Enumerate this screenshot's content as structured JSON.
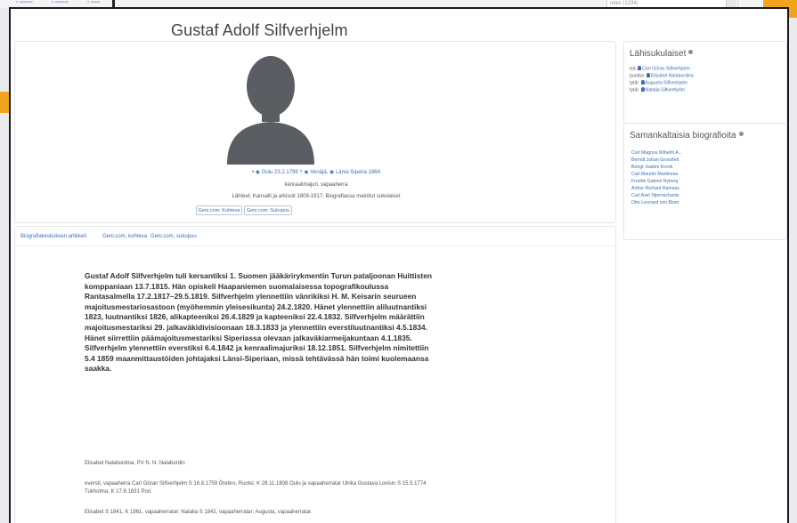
{
  "search": {
    "value": "mies (1234)"
  },
  "page": {
    "title": "Gustaf Adolf Silfverhjelm"
  },
  "profile": {
    "life_prefix": "•",
    "birth": "Oulu 23.2.1799 †",
    "death_place": "Venäjä",
    "region": "Länsi-Siperia 1864",
    "roles": "kenraalimajuri, vapaaherra",
    "sources": "Lähteet: Kansalli ja arkisoit 1809-1917. Biografiassa mainitut sukulaiset",
    "geni_buttons": [
      "Geni.com: Kohteva",
      "Geni.com: Sukupuu"
    ]
  },
  "tabs": [
    "Biografiakeskuksen artikkeli",
    "Geni.com, kohteva",
    "Geni.com, sukupuu"
  ],
  "bio": {
    "text": "Gustaf Adolf Silfverhjelm tuli kersantiksi 1. Suomen jääkärirykmentin Turun pataljoonan Huittisten komppaniaan 13.7.1815. Hän opiskeli Haapaniemen suomalaisessa topografikoulussa Rantasalmella 17.2.1817–29.5.1819. Silfverhjelm ylennettiin vänrikiksi H. M. Keisarin seurueen majoitusmestariosastoon (myöhemmin yleisesikunta) 24.2.1820. Hänet ylennettiin aliluutnantiksi 1823, luutnantiksi 1826, alikapteeniksi 26.4.1829 ja kapteeniksi 22.4.1832. Silfverhjelm määrättiin majoitusmestariksi 29. jalkaväkidivisioonaan 18.3.1833 ja ylennettiin everstiluutnantiksi 4.5.1834. Hänet siirrettiin päämajoitusmestariksi Siperiassa olevaan jalkaväkiarmeijakuntaan 4.1.1835. Silfverhjelm ylennettiin everstiksi 6.4.1842 ja kenraalimajuriksi 18.12.1851. Silfverhjelm nimitettiin 5.4 1859 maanmittaustöiden johtajaksi Länsi-Siperiaan, missä tehtävässä hän toimi kuolemaansa saakka.",
    "spouse": "Elisabet Nalabordina, PV N. N. Nalabordin",
    "parents": "eversti, vapaaherra Carl Göran Silfverhjelm S 16.8.1759 Örebro, Ruotsi, K 28.11.1808 Oulu ja vapaaherratar Ulrika Gustava Lovisin S 15.5.1774 Tukholma, K 17.8.1831 Pori.",
    "children": "Elisabet S 1841, K 1861, vapaaherratar; Natalia S 1842, vapaaherratar; Augusta, vapaaherratar."
  },
  "relatives": {
    "title": "Lähisukulaiset",
    "items": [
      {
        "role": "isä",
        "name": "Carl Göran Silfverhjelm"
      },
      {
        "role": "puoliso",
        "name": "Elisabet Nalabordina"
      },
      {
        "role": "tytär",
        "name": "Augusta Silfverhjelm"
      },
      {
        "role": "tytär",
        "name": "Natalia Silfverhjelm"
      }
    ]
  },
  "similar": {
    "title": "Samankaltaisia biografioita",
    "items": [
      "Carl Magnus Wihelm A...",
      "Berndt Johan Grossfelt",
      "Bengt Joakim Krook",
      "Carl Mauritz Martineau",
      "Fredrik Gabriel Nyberg",
      "Arthur Richard Ramsay",
      "Carl Axel Stjernschantz",
      "Otto Leonard von Blom"
    ]
  },
  "colors": {
    "accent": "#3b6fb6",
    "orange": "#f2a31f"
  }
}
